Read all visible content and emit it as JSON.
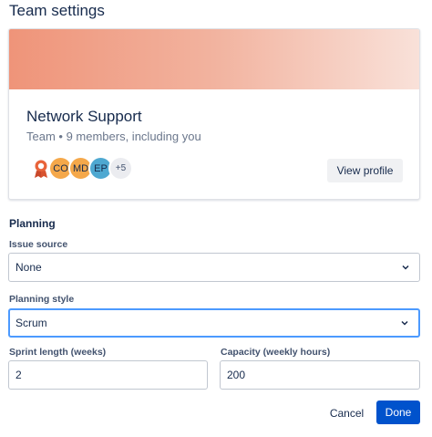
{
  "dialog": {
    "title": "Team settings"
  },
  "team": {
    "name": "Network Support",
    "meta": "Team • 9 members, including you",
    "avatars": [
      "CO",
      "MD",
      "EP"
    ],
    "more_count": "+5",
    "view_profile_label": "View profile",
    "banner_colors": [
      "#ef9479",
      "#f9e1d9"
    ]
  },
  "planning": {
    "heading": "Planning",
    "issue_source": {
      "label": "Issue source",
      "value": "None"
    },
    "planning_style": {
      "label": "Planning style",
      "value": "Scrum"
    },
    "sprint_length": {
      "label": "Sprint length (weeks)",
      "value": "2"
    },
    "capacity": {
      "label": "Capacity (weekly hours)",
      "value": "200"
    }
  },
  "footer": {
    "cancel_label": "Cancel",
    "done_label": "Done",
    "primary_color": "#0052cc"
  }
}
